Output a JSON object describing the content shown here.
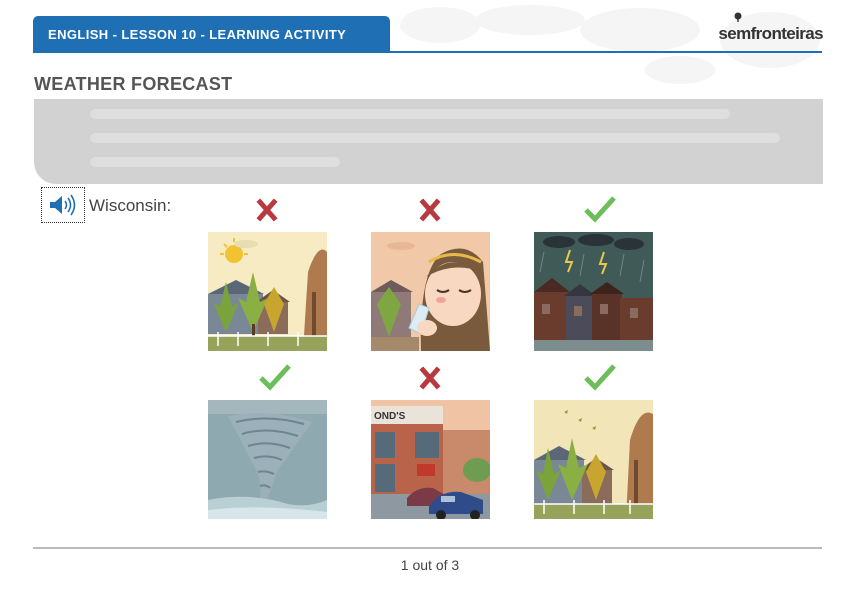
{
  "header": {
    "lesson_label": "ENGLISH - LESSON 10 - LEARNING ACTIVITY",
    "brand": "semfronteiras",
    "accent_color": "#1f6fb5"
  },
  "page_title": "WEATHER FORECAST",
  "question": {
    "audio_icon": "speaker-icon",
    "location_label": "Wisconsin:"
  },
  "answers": [
    {
      "scene": "sunny-autumn-park",
      "mark": "wrong"
    },
    {
      "scene": "girl-drinking-water",
      "mark": "wrong"
    },
    {
      "scene": "thunderstorm-houses",
      "mark": "correct"
    },
    {
      "scene": "tornado",
      "mark": "correct"
    },
    {
      "scene": "store-parking-lot",
      "mark": "wrong",
      "sign_text": "OND'S"
    },
    {
      "scene": "windy-autumn-park",
      "mark": "correct"
    }
  ],
  "colors": {
    "correct": "#6dbd5a",
    "wrong": "#b83a3f"
  },
  "footer": {
    "pager": "1 out of 3"
  }
}
